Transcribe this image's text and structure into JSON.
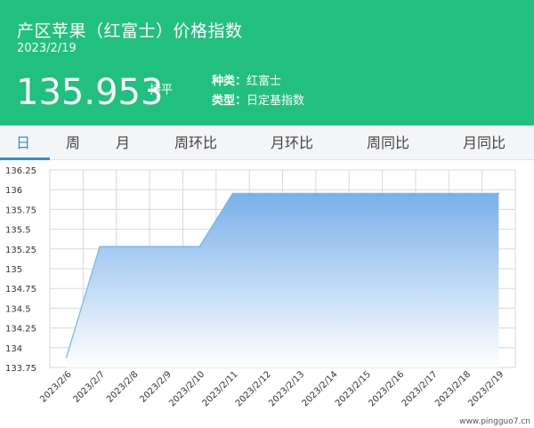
{
  "header": {
    "title": "产区苹果（红富士）价格指数",
    "date": "2023/2/19",
    "price": "135.953",
    "trend": "持平",
    "meta": [
      {
        "key": "种类：",
        "value": "红富士"
      },
      {
        "key": "类型：",
        "value": "日定基指数"
      }
    ]
  },
  "tabs": [
    {
      "label": "日",
      "active": true
    },
    {
      "label": "周",
      "active": false
    },
    {
      "label": "月",
      "active": false
    },
    {
      "label": "周环比",
      "active": false
    },
    {
      "label": "月环比",
      "active": false
    },
    {
      "label": "周同比",
      "active": false
    },
    {
      "label": "月同比",
      "active": false
    }
  ],
  "colors": {
    "header_bg": "#22c07e",
    "accent": "#2b8fd6",
    "series_line": "#7ab3e8",
    "area_top": "#7ab0ea",
    "area_bottom": "#ffffff",
    "grid": "#d5d9df"
  },
  "chart_data": {
    "type": "area",
    "x": [
      "2023/2/6",
      "2023/2/7",
      "2023/2/8",
      "2023/2/9",
      "2023/2/10",
      "2023/2/11",
      "2023/2/12",
      "2023/2/13",
      "2023/2/14",
      "2023/2/15",
      "2023/2/16",
      "2023/2/17",
      "2023/2/18",
      "2023/2/19"
    ],
    "series": [
      {
        "values": [
          133.88,
          135.28,
          135.28,
          135.28,
          135.28,
          135.953,
          135.953,
          135.953,
          135.953,
          135.953,
          135.953,
          135.953,
          135.953,
          135.953
        ]
      }
    ],
    "y_ticks": [
      "136.25",
      "136",
      "135.75",
      "135.5",
      "135.25",
      "135",
      "134.75",
      "134.5",
      "134.25",
      "134",
      "133.75"
    ],
    "ylim": [
      133.75,
      136.25
    ],
    "grid": true,
    "legend": "none"
  },
  "watermark": "www.pingguo7.cn"
}
